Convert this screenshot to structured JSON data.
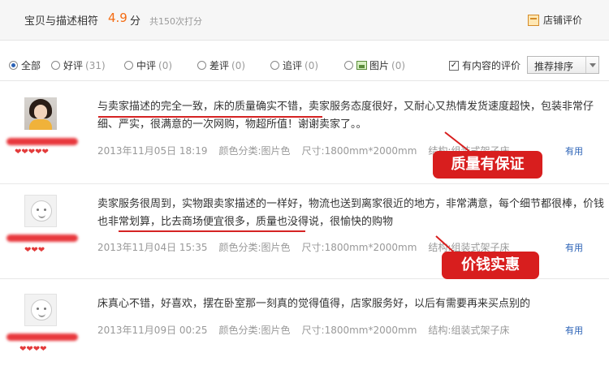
{
  "header": {
    "match_label": "宝贝与描述相符",
    "match_score": "4.9",
    "match_unit": "分",
    "match_count": "共150次打分",
    "shop_eval_label": "店铺评价",
    "shop_eval_icon": "shop-rating-icon"
  },
  "filters": {
    "all": {
      "label": "全部",
      "checked": true
    },
    "good": {
      "label": "好评",
      "count": "(31)"
    },
    "neutral": {
      "label": "中评",
      "count": "(0)"
    },
    "bad": {
      "label": "差评",
      "count": "(0)"
    },
    "followup": {
      "label": "追评",
      "count": "(0)"
    },
    "picture": {
      "label": "图片",
      "count": "(0)"
    },
    "has_content_label": "有内容的评价",
    "has_content_checked": true,
    "sort_label": "推荐排序"
  },
  "reviews": [
    {
      "rank": "❤❤❤❤❤",
      "text_highlight": "与卖家描述的完全一致，床的质量确实不错，",
      "text_rest": "卖家服务态度很好，又耐心又热情发货速度超快，包装非常仔细、严实，很满意的一次网购，物超所值！谢谢卖家了。。",
      "date": "2013年11月05日 18:19",
      "color": "颜色分类:图片色",
      "size": "尺寸:1800mm*2000mm",
      "structure": "结构:组装式架子床",
      "useful": "有用",
      "callout": "质量有保证"
    },
    {
      "rank": "❤❤❤",
      "text_before": "卖家服务很周到，实物跟卖家描述的一样好，物流也送到离家很近的地方，非常满意，每个细节都很棒，",
      "text_highlight": "价钱也非常划算，比去商场便宜很多，",
      "text_after": "质量也没得说，很愉快的购物",
      "date": "2013年11月04日 15:35",
      "color": "颜色分类:图片色",
      "size": "尺寸:1800mm*2000mm",
      "structure": "结构:组装式架子床",
      "useful": "有用",
      "callout": "价钱实惠"
    },
    {
      "rank": "❤❤❤❤",
      "text": "床真心不错，好喜欢，摆在卧室那一刻真的觉得值得，店家服务好，以后有需要再来买点别的",
      "date": "2013年11月09日 00:25",
      "color": "颜色分类:图片色",
      "size": "尺寸:1800mm*2000mm",
      "structure": "结构:组装式架子床",
      "useful": "有用"
    }
  ],
  "colors": {
    "accent_orange": "#f46c13",
    "callout_red": "#d81e1e",
    "link_blue": "#2b62b6"
  }
}
